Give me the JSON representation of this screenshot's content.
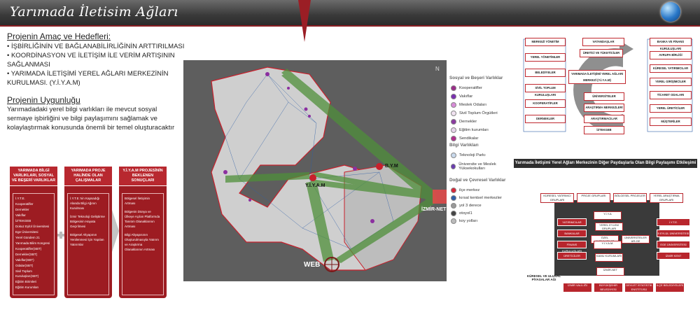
{
  "header": {
    "title": "Yarımada İletisim Ağları"
  },
  "purpose": {
    "heading": "Projenin Amaç ve Hedefleri:",
    "items": [
      "•  İŞBİRLİĞİNİN VE BAĞLANABİLİRLİĞİNİN ARTTIRILMASI",
      "•  KOORDİNASYON VE İLETİŞİM İLE VERİM ARTIŞININ",
      "SAĞLANMASI",
      "•  YARIMADA İLETİŞİMİ YEREL AĞLARI MERKEZİNİN",
      "KURULMASI. (Y.İ.Y.A.M)"
    ]
  },
  "suitability": {
    "heading": "Projenin Uygunluğu",
    "text": "Yarımadadaki yerel bilgi varlıkları ile mevcut sosyal sermaye işbirliğini ve bilgi paylaşımını sağlamak ve kolaylaştırmak konusunda önemli bir temel oluşturacaktır"
  },
  "columns": [
    {
      "title": "YARIMADA BİLGİ VARLIKLARI, SOSYAL VE BEŞERİ VARLIKLAR",
      "lines": [
        "İ.Y.T.E.",
        "Kooperatifler",
        "Dernekler",
        "Vakıflar",
        "İZTEKGEB",
        "Dokuz Eylül Üniversitesi",
        "Ege Üniversitesi",
        "Yerel Gündem 21",
        "Yarımada Bilim Kongresi",
        "Kooperatifler(SBT)",
        "Dernekler(SBT)",
        "Vakıflar(SBT)",
        "Odalar(SBT)",
        "Sivil Toplum Kuruluşları(SBT)",
        "Eğitim Birimleri",
        "Eğitim Kurumları"
      ]
    },
    {
      "title": "YARIMADA PROJE HALİNDE OLAN ÇALIŞMALAR",
      "lines": [
        "İ.Y.T.E.'nin Kapsadığı Alanda Bilgi Ağının Kurulması",
        "İzmir Teknoloji Geliştirme Bölgesinin Hayata Geçirilmesi",
        "Bölgesel Altyapının Yenilenmesi İçin Yapılan Yatırımlar"
      ]
    },
    {
      "title": "Y.İ.Y.A.M PROJESİNİN BEKLENEN SONUÇLARI",
      "lines": [
        "Bölgesel İletişimin Artması",
        "Bölgenin Dünya ve Ülkeye Açılan Platformda Tanıtım Olanaklarının Artması",
        "Bilgi Altyapısının Oluşturulmasıyla Yatırım ve Araştırma Olanaklarının Artması"
      ]
    }
  ],
  "map": {
    "labels": {
      "center": "Y.İ.Y.A.M",
      "bym": "B.Y.M",
      "izmir": "İZMİR-NET",
      "web": "WEB"
    },
    "compass": "N"
  },
  "legend": {
    "social_title": "Sosyal ve Beşeri Varlıklar",
    "social": [
      {
        "label": "Kooperatifler",
        "color": "#9b2d8a"
      },
      {
        "label": "Vakıflar",
        "color": "#7a2fb0"
      },
      {
        "label": "Meslek Odaları",
        "color": "#d88bd8"
      },
      {
        "label": "Sivil Toplum Örgütleri",
        "color": "#f0e2f0"
      },
      {
        "label": "Dernekler",
        "color": "#8b3aa0"
      },
      {
        "label": "Eğitim kurumları",
        "color": "#e6d4ea"
      },
      {
        "label": "Sendikalar",
        "color": "#b02e8c"
      }
    ],
    "info_title": "Bilgi Varlıkları",
    "info": [
      {
        "label": "Teknoloji Parkı",
        "color": "#c9d9ec"
      },
      {
        "label": "Üniversite ve Meslek Yüksekokulları",
        "color": "#6a3cb0"
      }
    ],
    "nature_title": "Doğal ve Çevresel Varlıklar",
    "nature": [
      {
        "label": "ilçe merkez",
        "color": "#d8283a"
      },
      {
        "label": "kırsal kentsel merkezler",
        "color": "#2f5fa8"
      },
      {
        "label": "yol 3 derece",
        "color": "#999999"
      },
      {
        "label": "otoyol1",
        "color": "#444444"
      },
      {
        "label": "koy yolları",
        "color": "#bbbbbb"
      }
    ]
  },
  "diagram1": {
    "left": [
      "MERKEZİ YÖNETİM",
      "YEREL YÖNETİMLER",
      "BELEDİYELER",
      "SİVİL TOPLUM KURULUŞLARI",
      "KOOPERATİFLER",
      "DERNEKLER"
    ],
    "center": [
      "VATANDAŞLAR",
      "ÜRETİCİ VE TÜKETİCİLER",
      "YARIMADA İLETİŞİMİ YEREL AĞLARI MERKEZİ (Y.İ.Y.A.M)",
      "ÜNİVERSİTELER",
      "ARAŞTIRMA MERKEZLERİ",
      "ARAŞTIRMACILAR",
      "İZTEKGEB"
    ],
    "right": [
      "BANKA VE FİNANS KURULUŞLARI",
      "AVRUPA BİRLİĞİ",
      "KÜRESEL YATIRIMCILAR",
      "YEREL GİRİŞİMCİLER",
      "TİCARET ODALARI",
      "YEREL ÜRETİCİLER",
      "MÜŞTERİLER"
    ]
  },
  "diagram2": {
    "caption": "Yarımada İletişimi Yerel Ağları Merkezinin Diğer Paydaşlarla Olan Bilgi Paylaşımı Etkileşimi",
    "top": [
      "KÜRESEL YATIRIMCI GRUPLARI",
      "PROJE GRUPLARI",
      "BÖLGESEL PROJELER",
      "YEREL ARAŞTIRMA GRUPLARI"
    ],
    "left": [
      "YATIRIMCILAR",
      "BANKALAR",
      "FİNANS KURULUŞLARI",
      "ÜRETİCİLER"
    ],
    "right": [
      "İ.Y.T.E.",
      "9 EYLÜL ÜNİVERSİTESİ",
      "EGE ÜNİVERSİTESİ",
      "İZMİR KENT"
    ],
    "inner": [
      "Y.İ.Y.A",
      "YEREL EYLEM GRUPLARI",
      "ÖZEL KURULUŞLAR",
      "Y.İ.Y.A.M.",
      "ÜNİVERSİTELER AR-GE",
      "KAMU KURUMLARI",
      "İZMİR-NET"
    ],
    "bottom_label": "KÜRESEL VE ULUSAL PİYASALAR AĞI",
    "bottom": [
      "İZMİR VALİLİĞİ",
      "BÜYÜKŞEHİR BELEDİYESİ",
      "DEVLET İSTATİSTİK ENSTİTÜSÜ",
      "İLÇE BELEDİYELERİ"
    ]
  }
}
